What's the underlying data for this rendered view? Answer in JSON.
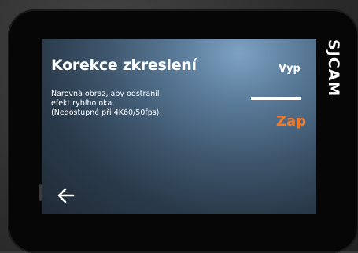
{
  "brand": {
    "logo_text": "SJCAM"
  },
  "setting": {
    "title": "Korekce zkreslení",
    "description_lines": [
      "Narovná obraz, aby odstranil",
      "efekt rybího oka.",
      "(Nedostupné při 4K60/50fps)"
    ]
  },
  "options": {
    "off_label": "Vyp",
    "on_label": "Zap",
    "selected": "Zap"
  },
  "nav": {
    "back_icon": "arrow-left-icon"
  },
  "colors": {
    "selected_option": "#f07a2a",
    "text": "#ffffff"
  }
}
